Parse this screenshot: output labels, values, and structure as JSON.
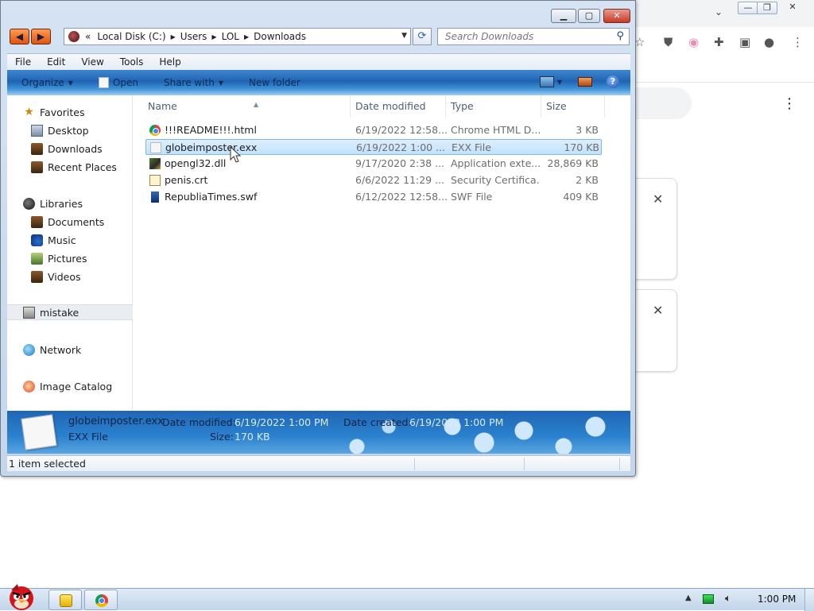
{
  "explorer": {
    "address": {
      "overflow": "«",
      "segments": [
        "Local Disk (C:)",
        "Users",
        "LOL",
        "Downloads"
      ]
    },
    "search": {
      "placeholder": "Search Downloads"
    },
    "menu": [
      "File",
      "Edit",
      "View",
      "Tools",
      "Help"
    ],
    "commands": {
      "organize": "Organize",
      "open": "Open",
      "share_with": "Share with",
      "new_folder": "New folder"
    },
    "sidebar": {
      "favorites": {
        "label": "Favorites",
        "items": [
          "Desktop",
          "Downloads",
          "Recent Places"
        ]
      },
      "libraries": {
        "label": "Libraries",
        "items": [
          "Documents",
          "Music",
          "Pictures",
          "Videos"
        ]
      },
      "homegroup": "mistake",
      "network": "Network",
      "image_catalog": "Image Catalog"
    },
    "columns": {
      "name": "Name",
      "date_modified": "Date modified",
      "type": "Type",
      "size": "Size"
    },
    "files": [
      {
        "name": "!!!README!!!.html",
        "date": "6/19/2022 12:58...",
        "type": "Chrome HTML D...",
        "size": "3 KB",
        "icon": "chrome-file-icon"
      },
      {
        "name": "globeimposter.exx",
        "date": "6/19/2022 1:00 ...",
        "type": "EXX File",
        "size": "170 KB",
        "icon": "blank-file-icon"
      },
      {
        "name": "opengl32.dll",
        "date": "9/17/2020 2:38 ...",
        "type": "Application exte...",
        "size": "28,869 KB",
        "icon": "dll-file-icon"
      },
      {
        "name": "penis.crt",
        "date": "6/6/2022 11:29 ...",
        "type": "Security Certifica...",
        "size": "2 KB",
        "icon": "certificate-file-icon"
      },
      {
        "name": "RepubliaTimes.swf",
        "date": "6/12/2022 12:58...",
        "type": "SWF File",
        "size": "409 KB",
        "icon": "swf-file-icon"
      }
    ],
    "details": {
      "filename": "globeimposter.exx",
      "filetype": "EXX File",
      "date_modified_label": "Date modified:",
      "date_modified_value": "6/19/2022 1:00 PM",
      "size_label": "Size:",
      "size_value": "170 KB",
      "date_created_label": "Date created:",
      "date_created_value": "6/19/2022 1:00 PM"
    },
    "status": "1 item selected"
  },
  "taskbar": {
    "clock": "1:00 PM"
  },
  "colors": {
    "command_bar": "#1f63b3",
    "selection": "#c3e2fb",
    "close_button": "#c43b25",
    "taskbar": "#c2d5ea"
  }
}
